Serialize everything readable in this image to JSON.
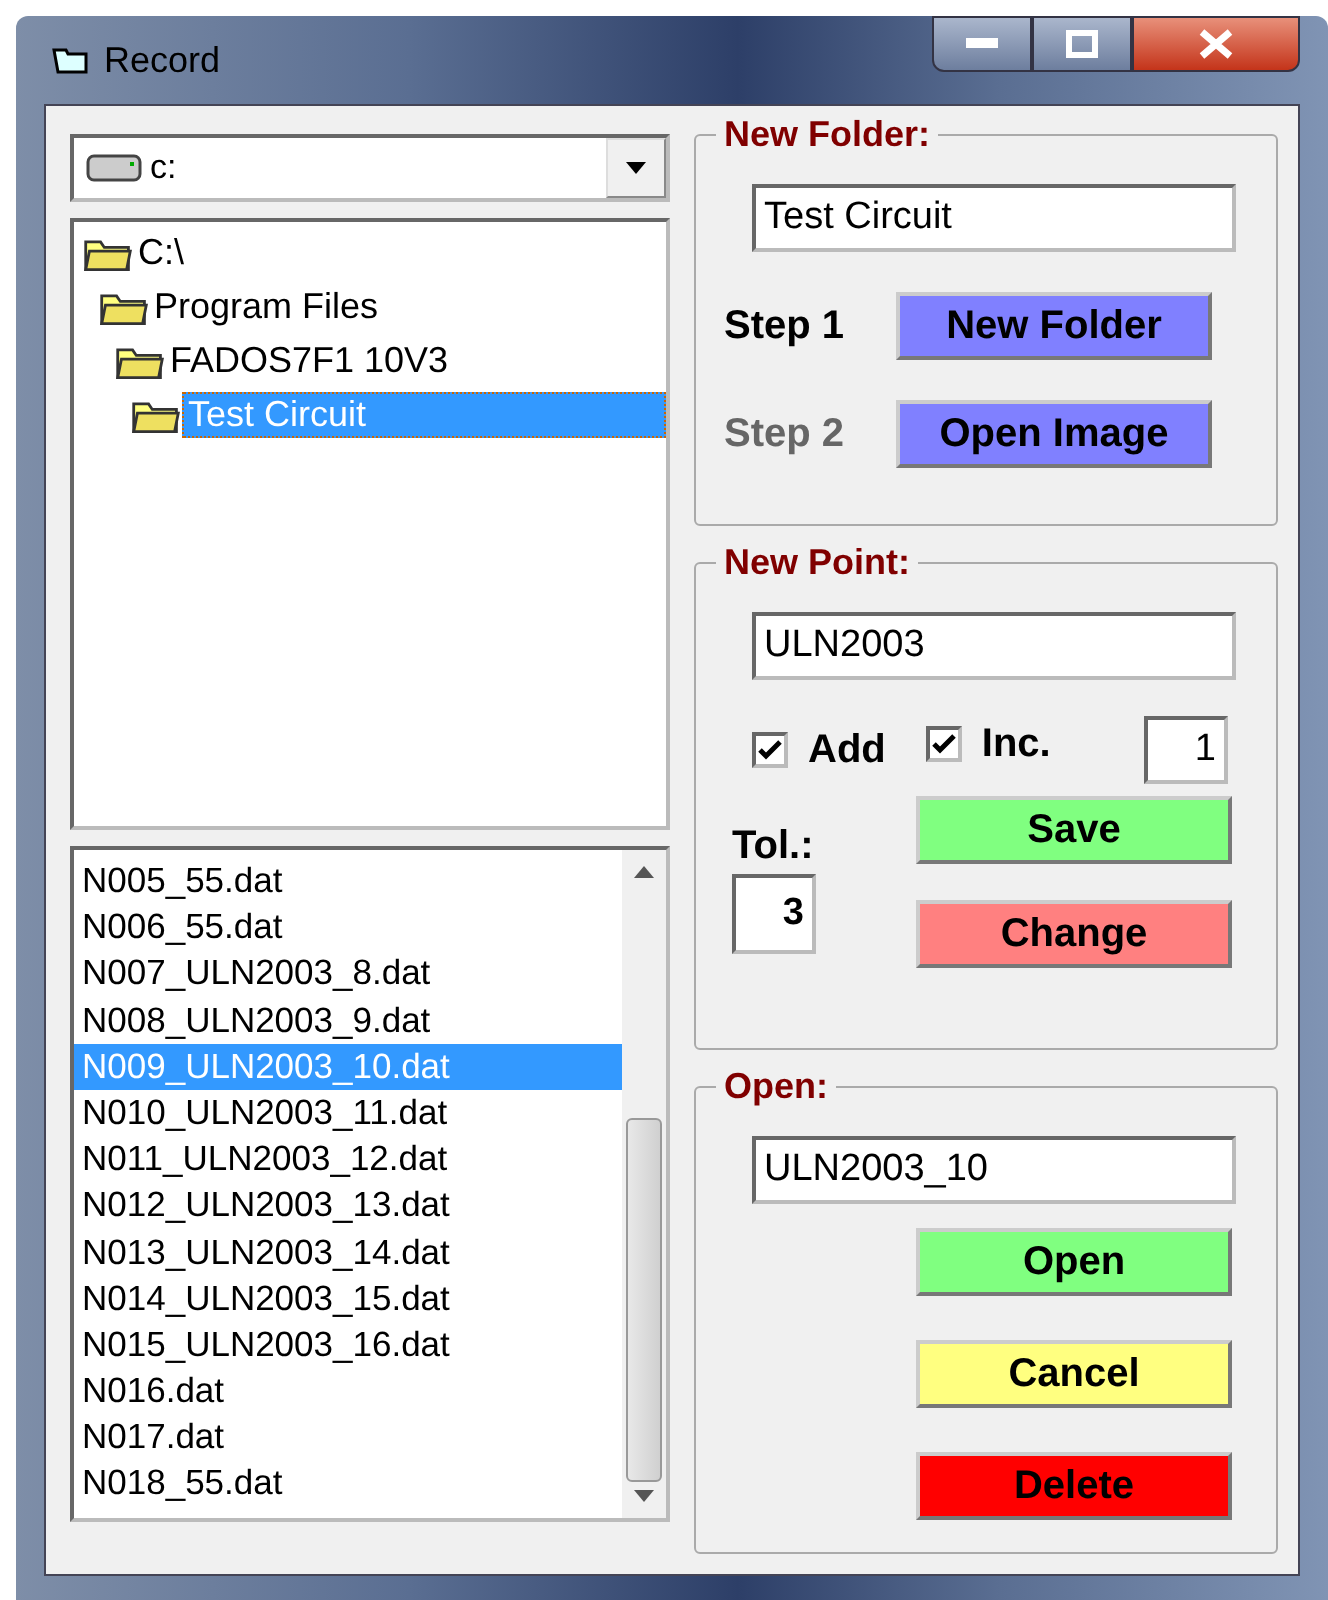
{
  "window": {
    "title": "Record"
  },
  "drive": {
    "value": "c:"
  },
  "folders": [
    {
      "label": "C:\\",
      "selected": false,
      "children": [
        {
          "label": "Program Files",
          "selected": false,
          "children": [
            {
              "label": "FADOS7F1 10V3",
              "selected": false,
              "children": [
                {
                  "label": "Test Circuit",
                  "selected": true
                }
              ]
            }
          ]
        }
      ]
    }
  ],
  "files": [
    {
      "label": "N005_55.dat",
      "selected": false
    },
    {
      "label": "N006_55.dat",
      "selected": false
    },
    {
      "label": "N007_ULN2003_8.dat",
      "selected": false
    },
    {
      "label": "N008_ULN2003_9.dat",
      "selected": false
    },
    {
      "label": "N009_ULN2003_10.dat",
      "selected": true
    },
    {
      "label": "N010_ULN2003_11.dat",
      "selected": false
    },
    {
      "label": "N011_ULN2003_12.dat",
      "selected": false
    },
    {
      "label": "N012_ULN2003_13.dat",
      "selected": false
    },
    {
      "label": "N013_ULN2003_14.dat",
      "selected": false
    },
    {
      "label": "N014_ULN2003_15.dat",
      "selected": false
    },
    {
      "label": "N015_ULN2003_16.dat",
      "selected": false
    },
    {
      "label": "N016.dat",
      "selected": false
    },
    {
      "label": "N017.dat",
      "selected": false
    },
    {
      "label": "N018_55.dat",
      "selected": false
    }
  ],
  "new_folder": {
    "title": "New Folder:",
    "name": "Test Circuit",
    "steps": [
      {
        "label": "Step 1",
        "disabled": false,
        "button": "New Folder",
        "color": "#8080ff"
      },
      {
        "label": "Step 2",
        "disabled": true,
        "button": "Open Image",
        "color": "#8080ff"
      }
    ]
  },
  "new_point": {
    "title": "New Point:",
    "name": "ULN2003",
    "add": {
      "label": "Add",
      "checked": true
    },
    "inc": {
      "label": "Inc.",
      "checked": true
    },
    "increment": "1",
    "tolerance_label": "Tol.:",
    "tolerance": "3",
    "buttons": [
      {
        "label": "Save",
        "color": "#80ff80"
      },
      {
        "label": "Change",
        "color": "#ff8080"
      }
    ]
  },
  "open": {
    "title": "Open:",
    "name": "ULN2003_10",
    "buttons": [
      {
        "label": "Open",
        "color": "#80ff80"
      },
      {
        "label": "Cancel",
        "color": "#ffff80"
      },
      {
        "label": "Delete",
        "color": "#ff0000"
      }
    ]
  }
}
